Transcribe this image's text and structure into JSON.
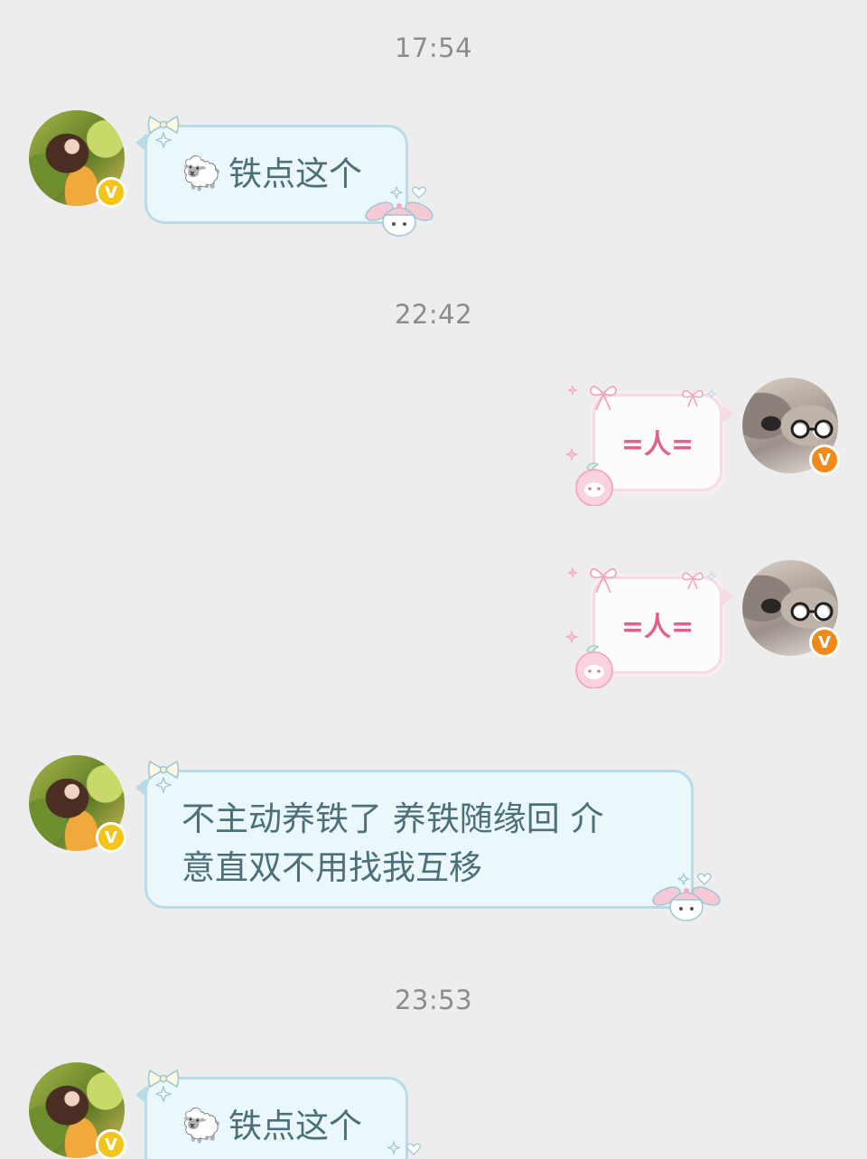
{
  "timestamps": [
    "17:54",
    "22:42",
    "23:53"
  ],
  "badge_glyph": "V",
  "messages": [
    {
      "sender": "other",
      "emoji": "🐑",
      "text": "铁点这个"
    },
    {
      "sender": "self",
      "text": "=人="
    },
    {
      "sender": "self",
      "text": "=人="
    },
    {
      "sender": "other",
      "text_line1": "不主动养铁了 养铁随缘回 介",
      "text_line2": "意直双不用找我互移"
    },
    {
      "sender": "other",
      "emoji": "🐑",
      "text": "铁点这个"
    }
  ],
  "colors": {
    "background": "#ededed",
    "timestamp": "#8c8c8c",
    "bubble_blue_fill": "#eaf7fb",
    "bubble_blue_border": "#b9dbe5",
    "bubble_pink_border": "#f5dbe4",
    "text_teal": "#4d7078",
    "text_pink": "#e0628f",
    "badge_yellow": "#f3c51a",
    "badge_orange": "#f08a1a"
  },
  "icons": {
    "other_avatar": "avatar-woman-photo",
    "self_avatar": "avatar-dog-glasses-photo",
    "sheep": "sheep-icon",
    "bow": "bow-icon",
    "bunny": "bunny-sticker-icon",
    "peach": "peach-sticker-icon",
    "heart": "heart-icon",
    "sparkle": "sparkle-icon"
  }
}
